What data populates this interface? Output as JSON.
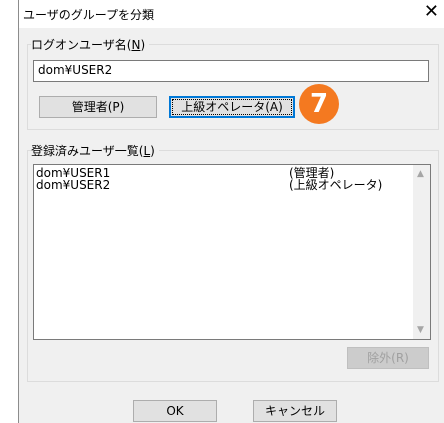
{
  "dialog": {
    "title": "ユーザのグループを分類",
    "close_glyph": "✕"
  },
  "logon_group": {
    "label": "ログオンユーザ名(",
    "accel": "N",
    "label_end": ")",
    "value": "dom¥USER2"
  },
  "buttons": {
    "admin": "管理者(P)",
    "advanced_operator": "上級オペレータ(A)",
    "remove": "除外(R)",
    "ok": "OK",
    "cancel": "キャンセル"
  },
  "badge": {
    "text": "7",
    "color": "#f47920"
  },
  "registered_group": {
    "label": "登録済みユーザ一覧(",
    "accel": "L",
    "label_end": ")",
    "items": [
      {
        "user": "dom¥USER1",
        "role": "(管理者)"
      },
      {
        "user": "dom¥USER2",
        "role": "(上級オペレータ)"
      }
    ]
  }
}
